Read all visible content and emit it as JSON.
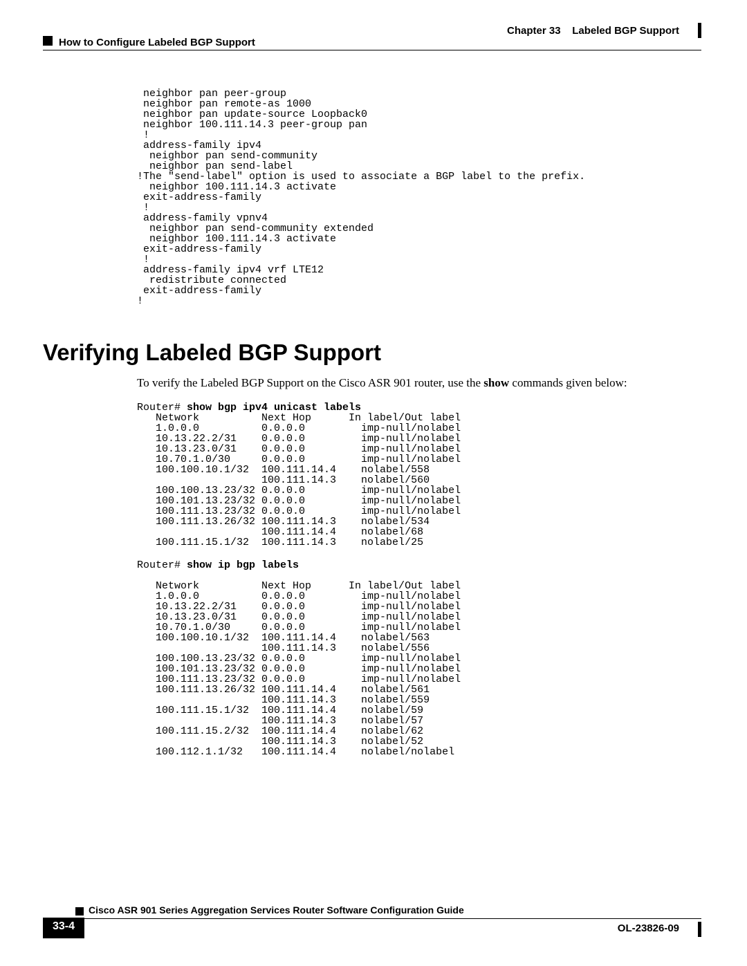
{
  "header": {
    "chapter_label": "Chapter 33",
    "chapter_title": "Labeled BGP Support",
    "section_breadcrumb": "How to Configure Labeled BGP Support"
  },
  "config_block": " neighbor pan peer-group\n neighbor pan remote-as 1000\n neighbor pan update-source Loopback0\n neighbor 100.111.14.3 peer-group pan\n !\n address-family ipv4\n  neighbor pan send-community\n  neighbor pan send-label\n!The \"send-label\" option is used to associate a BGP label to the prefix.\n  neighbor 100.111.14.3 activate\n exit-address-family\n !\n address-family vpnv4\n  neighbor pan send-community extended\n  neighbor 100.111.14.3 activate\n exit-address-family\n !\n address-family ipv4 vrf LTE12\n  redistribute connected\n exit-address-family\n!",
  "section_heading": "Verifying Labeled BGP Support",
  "intro_para_pre": "To verify the Labeled BGP Support on the Cisco ASR 901 router, use the ",
  "intro_para_bold": "show",
  "intro_para_post": " commands given below:",
  "cli1_prompt": "Router# ",
  "cli1_cmd": "show bgp ipv4 unicast labels",
  "cli1_output": "   Network          Next Hop      In label/Out label\n   1.0.0.0          0.0.0.0         imp-null/nolabel\n   10.13.22.2/31    0.0.0.0         imp-null/nolabel\n   10.13.23.0/31    0.0.0.0         imp-null/nolabel\n   10.70.1.0/30     0.0.0.0         imp-null/nolabel\n   100.100.10.1/32  100.111.14.4    nolabel/558\n                    100.111.14.3    nolabel/560\n   100.100.13.23/32 0.0.0.0         imp-null/nolabel\n   100.101.13.23/32 0.0.0.0         imp-null/nolabel\n   100.111.13.23/32 0.0.0.0         imp-null/nolabel\n   100.111.13.26/32 100.111.14.3    nolabel/534\n                    100.111.14.4    nolabel/68\n   100.111.15.1/32  100.111.14.3    nolabel/25",
  "cli2_prompt": "Router# ",
  "cli2_cmd": "show ip bgp labels",
  "cli2_output": "\n   Network          Next Hop      In label/Out label\n   1.0.0.0          0.0.0.0         imp-null/nolabel\n   10.13.22.2/31    0.0.0.0         imp-null/nolabel\n   10.13.23.0/31    0.0.0.0         imp-null/nolabel\n   10.70.1.0/30     0.0.0.0         imp-null/nolabel\n   100.100.10.1/32  100.111.14.4    nolabel/563\n                    100.111.14.3    nolabel/556\n   100.100.13.23/32 0.0.0.0         imp-null/nolabel\n   100.101.13.23/32 0.0.0.0         imp-null/nolabel\n   100.111.13.23/32 0.0.0.0         imp-null/nolabel\n   100.111.13.26/32 100.111.14.4    nolabel/561\n                    100.111.14.3    nolabel/559\n   100.111.15.1/32  100.111.14.4    nolabel/59\n                    100.111.14.3    nolabel/57\n   100.111.15.2/32  100.111.14.4    nolabel/62\n                    100.111.14.3    nolabel/52\n   100.112.1.1/32   100.111.14.4    nolabel/nolabel",
  "footer": {
    "guide_title": "Cisco ASR 901 Series Aggregation Services Router Software Configuration Guide",
    "page_number": "33-4",
    "doc_number": "OL-23826-09"
  }
}
